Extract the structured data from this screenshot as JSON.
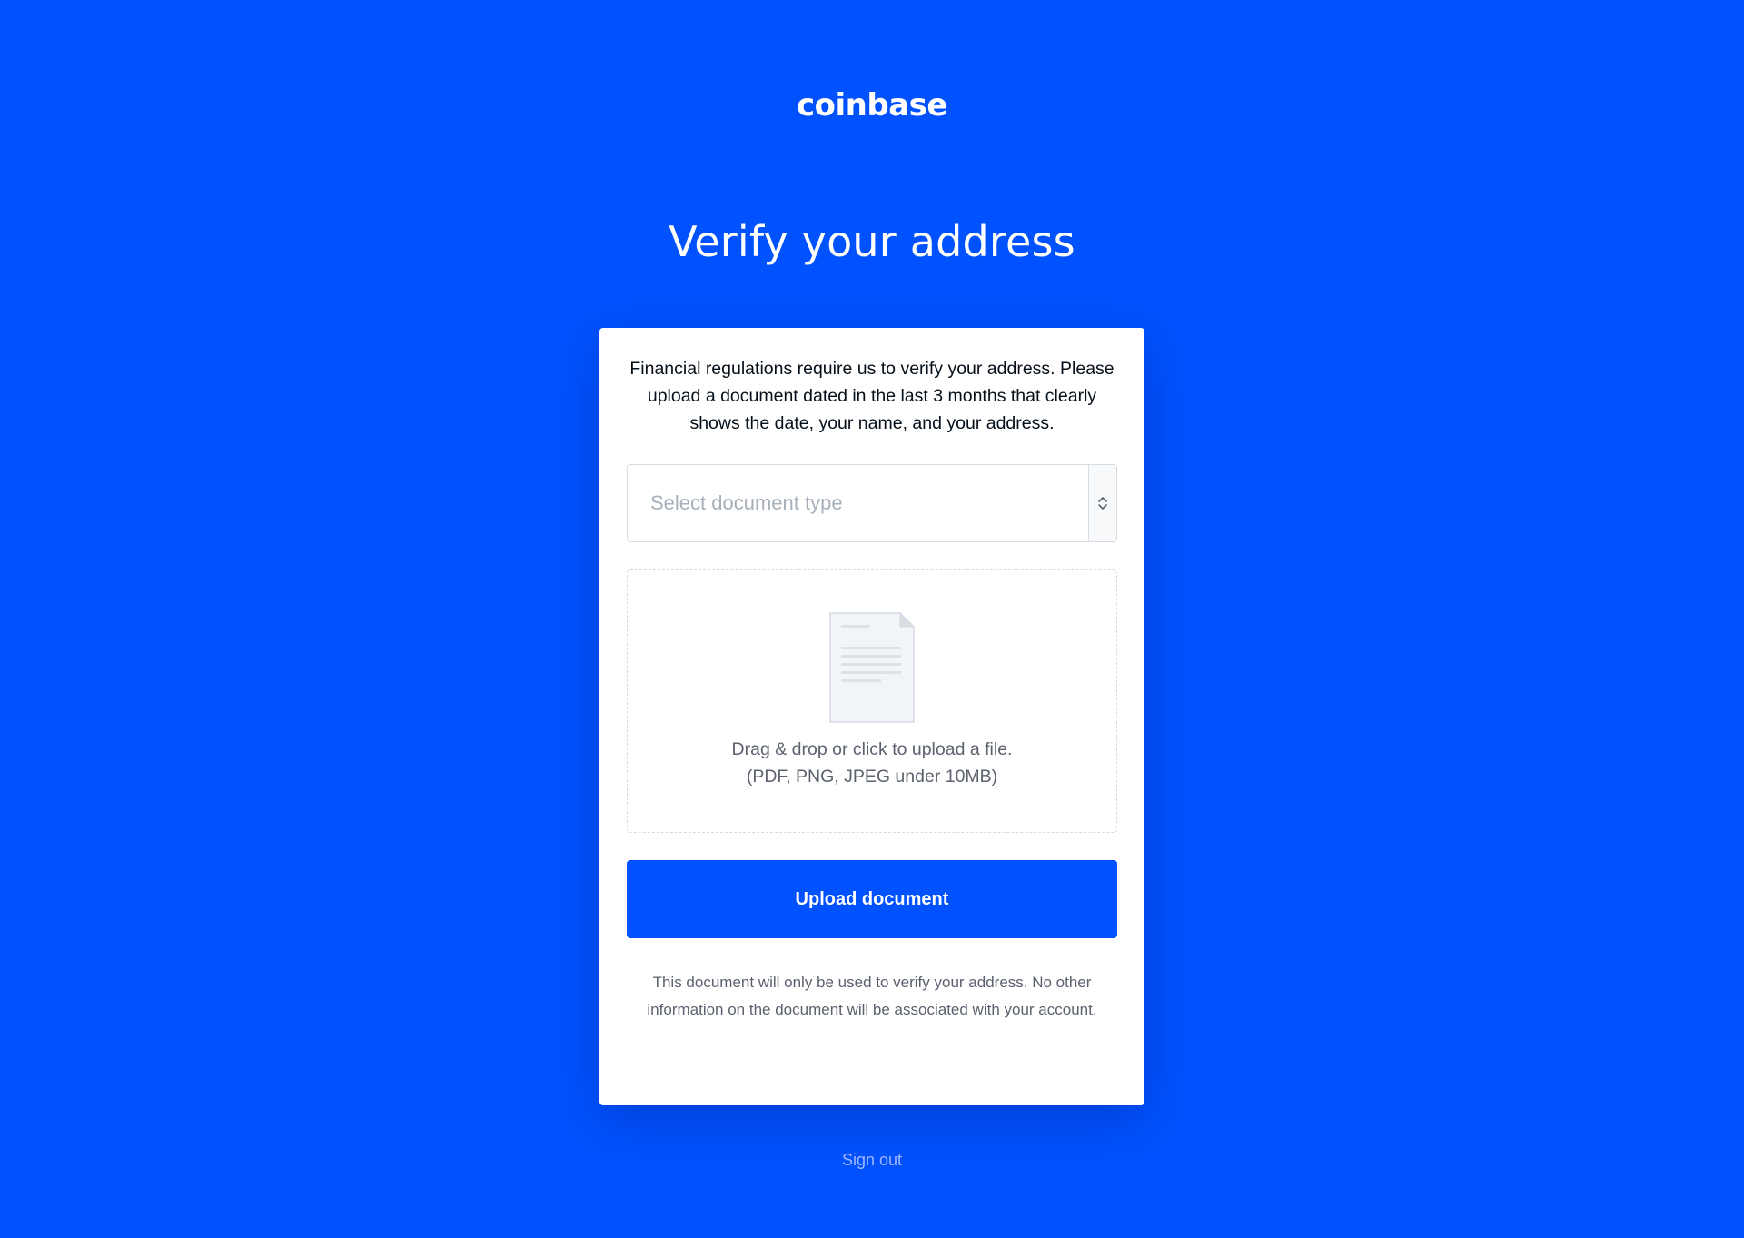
{
  "header": {
    "logo_text": "coinbase"
  },
  "page": {
    "title": "Verify your address"
  },
  "card": {
    "intro": "Financial regulations require us to verify your address. Please upload a document dated in the last 3 months that clearly shows the date, your name, and your address.",
    "document_type_select": {
      "placeholder": "Select document type",
      "icon": "chevron-up-down-icon"
    },
    "dropzone": {
      "icon": "document-icon",
      "instruction": "Drag & drop or click to upload a file.",
      "formats": "(PDF, PNG, JPEG under 10MB)"
    },
    "upload_button_label": "Upload document",
    "disclaimer": "This document will only be used to verify your address. No other information on the document will be associated with your account."
  },
  "footer": {
    "signout_label": "Sign out"
  },
  "colors": {
    "brand_blue": "#0052ff",
    "card_background": "#ffffff",
    "muted_text": "#5b616e",
    "placeholder_text": "#a8b0ba",
    "signout_text": "#9fb6ff"
  }
}
